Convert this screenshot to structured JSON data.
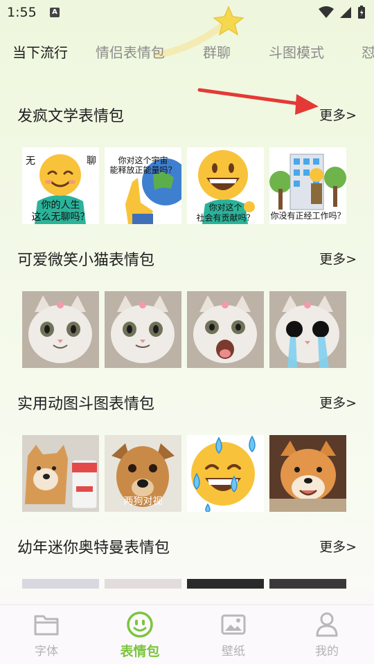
{
  "status_bar": {
    "time": "1:55",
    "notification_letter": "A"
  },
  "tabs": [
    {
      "label": "当下流行",
      "active": true
    },
    {
      "label": "情侣表情包",
      "active": false
    },
    {
      "label": "群聊",
      "active": false
    },
    {
      "label": "斗图模式",
      "active": false
    },
    {
      "label": "怼",
      "active": false
    }
  ],
  "sections": [
    {
      "title": "发疯文学表情包",
      "more": "更多>",
      "items": [
        {
          "top": "无",
          "top2": "聊",
          "bottom": "你的人生",
          "bottom2": "这么无聊吗？"
        },
        {
          "top": "你对这个宇宙",
          "top2": "能释放正能量吗？"
        },
        {
          "bottom": "你对这个",
          "bottom2": "社会有贡献吗？"
        },
        {
          "bottom": "你没有正经工作吗？"
        }
      ]
    },
    {
      "title": "可爱微笑小猫表情包",
      "more": "更多>"
    },
    {
      "title": "实用动图斗图表情包",
      "more": "更多>",
      "items": [
        {},
        {
          "bottom": "两狗对视"
        },
        {},
        {}
      ]
    },
    {
      "title": "幼年迷你奥特曼表情包",
      "more": "更多>"
    }
  ],
  "bottom_nav": [
    {
      "label": "字体",
      "icon": "folder-icon",
      "active": false
    },
    {
      "label": "表情包",
      "icon": "smiley-icon",
      "active": true
    },
    {
      "label": "壁纸",
      "icon": "image-icon",
      "active": false
    },
    {
      "label": "我的",
      "icon": "person-icon",
      "active": false
    }
  ],
  "colors": {
    "accent": "#7bc53d",
    "arrow": "#e53935",
    "inactive": "#b3b3b3"
  }
}
